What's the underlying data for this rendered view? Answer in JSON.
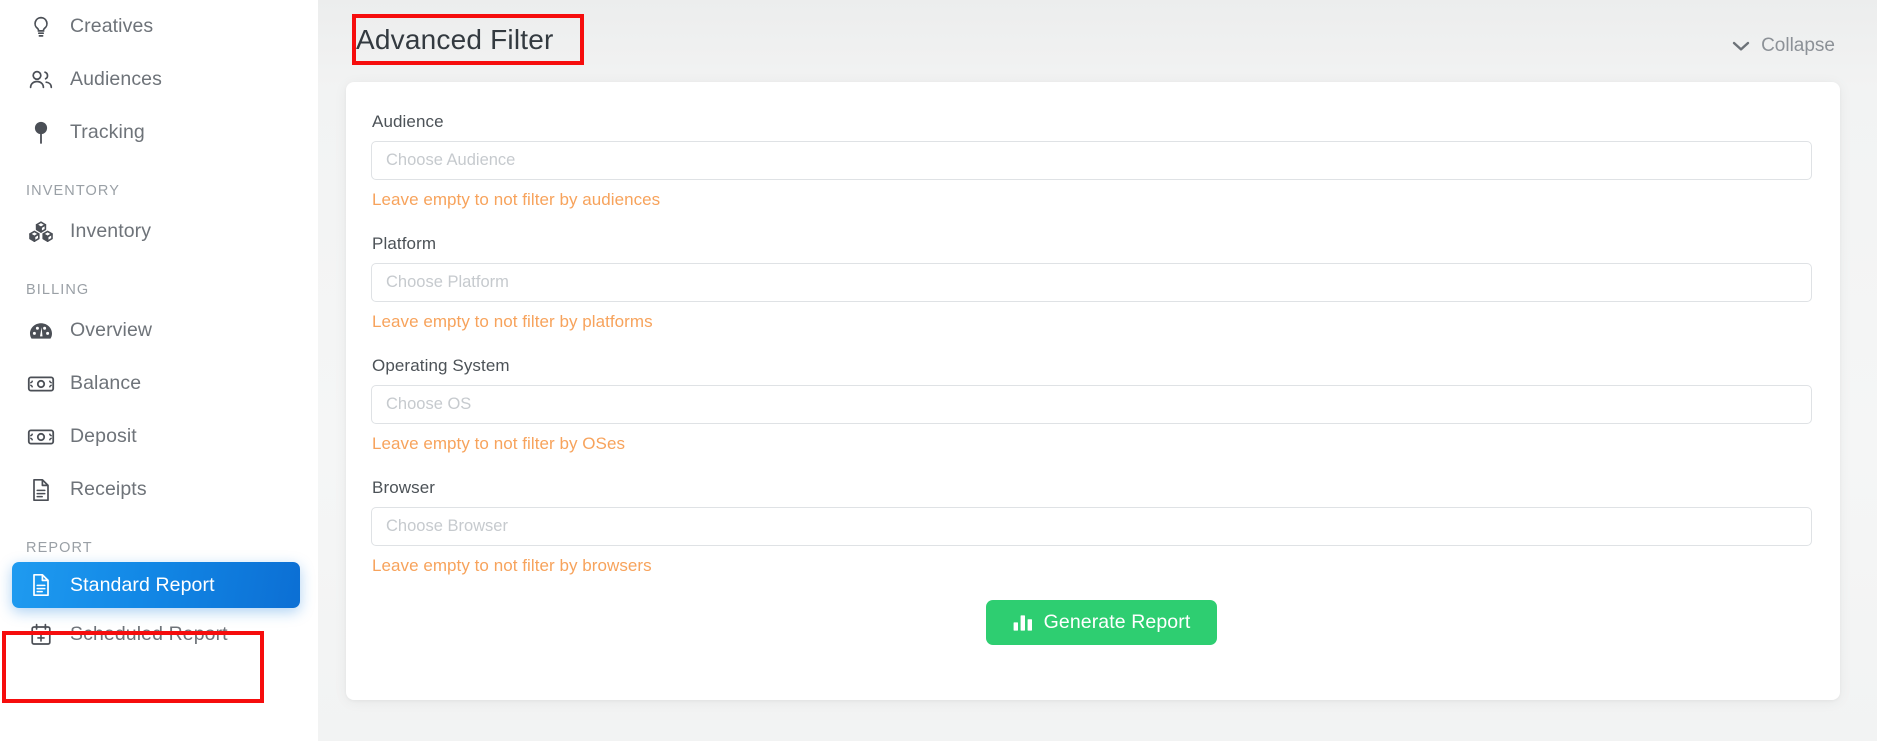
{
  "sidebar": {
    "items": [
      {
        "id": "creatives",
        "label": "Creatives",
        "icon": "lightbulb-icon",
        "type": "item",
        "active": false
      },
      {
        "id": "audiences",
        "label": "Audiences",
        "icon": "users-icon",
        "type": "item",
        "active": false
      },
      {
        "id": "tracking",
        "label": "Tracking",
        "icon": "map-pin-icon",
        "type": "item",
        "active": false
      },
      {
        "id": "inventory-header",
        "label": "INVENTORY",
        "icon": "",
        "type": "section",
        "active": false
      },
      {
        "id": "inventory",
        "label": "Inventory",
        "icon": "boxes-icon",
        "type": "item",
        "active": false
      },
      {
        "id": "billing-header",
        "label": "BILLING",
        "icon": "",
        "type": "section",
        "active": false
      },
      {
        "id": "overview",
        "label": "Overview",
        "icon": "tachometer-icon",
        "type": "item",
        "active": false
      },
      {
        "id": "balance",
        "label": "Balance",
        "icon": "money-bill-icon",
        "type": "item",
        "active": false
      },
      {
        "id": "deposit",
        "label": "Deposit",
        "icon": "money-bill-icon",
        "type": "item",
        "active": false
      },
      {
        "id": "receipts",
        "label": "Receipts",
        "icon": "file-lines-icon",
        "type": "item",
        "active": false
      },
      {
        "id": "report-header",
        "label": "REPORT",
        "icon": "",
        "type": "section",
        "active": false
      },
      {
        "id": "standard-report",
        "label": "Standard Report",
        "icon": "file-lines-icon",
        "type": "item",
        "active": true
      },
      {
        "id": "scheduled-report",
        "label": "Scheduled Report",
        "icon": "calendar-plus-icon",
        "type": "item",
        "active": false
      }
    ]
  },
  "header": {
    "title": "Advanced Filter",
    "collapse_label": "Collapse",
    "collapse_icon": "chevron-down-icon"
  },
  "filter_form": {
    "fields": [
      {
        "id": "audience",
        "label": "Audience",
        "placeholder": "Choose Audience",
        "value": "",
        "hint": "Leave empty to not filter by audiences"
      },
      {
        "id": "platform",
        "label": "Platform",
        "placeholder": "Choose Platform",
        "value": "",
        "hint": "Leave empty to not filter by platforms"
      },
      {
        "id": "operating-system",
        "label": "Operating System",
        "placeholder": "Choose OS",
        "value": "",
        "hint": "Leave empty to not filter by OSes"
      },
      {
        "id": "browser",
        "label": "Browser",
        "placeholder": "Choose Browser",
        "value": "",
        "hint": "Leave empty to not filter by browsers"
      }
    ],
    "generate_button": {
      "label": "Generate Report",
      "icon": "bar-chart-icon"
    }
  },
  "colors": {
    "accent_blue": "#1288e6",
    "accent_green": "#2ece71",
    "hint_orange": "#f7a35c",
    "annotation_red": "#f60d0d",
    "page_background": "#f3f4f4",
    "card_background": "#ffffff"
  }
}
